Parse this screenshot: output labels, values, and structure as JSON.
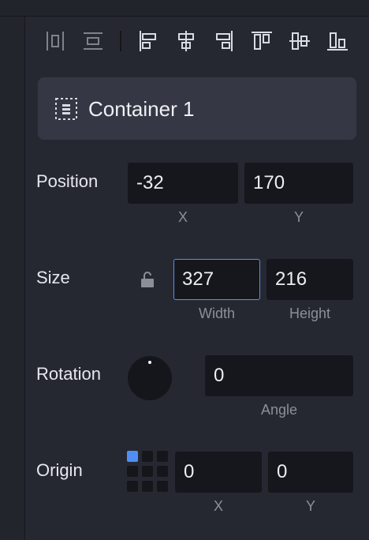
{
  "header": {
    "title": "Container 1",
    "icon": "container-icon"
  },
  "toolbar": {
    "buttons": [
      "distribute-horizontal-icon",
      "distribute-vertical-icon",
      "align-left-icon",
      "align-horizontal-center-icon",
      "align-right-icon",
      "align-top-icon",
      "align-vertical-center-icon",
      "align-bottom-icon"
    ]
  },
  "position": {
    "label": "Position",
    "x": "-32",
    "y": "170",
    "x_caption": "X",
    "y_caption": "Y"
  },
  "size": {
    "label": "Size",
    "width": "327",
    "height": "216",
    "width_caption": "Width",
    "height_caption": "Height",
    "lock_icon": "unlocked-icon"
  },
  "rotation": {
    "label": "Rotation",
    "angle": "0",
    "angle_caption": "Angle",
    "dial_icon": "rotation-dial"
  },
  "origin": {
    "label": "Origin",
    "x": "0",
    "y": "0",
    "x_caption": "X",
    "y_caption": "Y",
    "selected_cell": "top-left"
  },
  "colors": {
    "accent": "#5d8bf4",
    "origin_selected": "#4f8ff5",
    "panel_bg": "#262831",
    "field_bg": "#16171d",
    "header_bg": "#353844"
  }
}
